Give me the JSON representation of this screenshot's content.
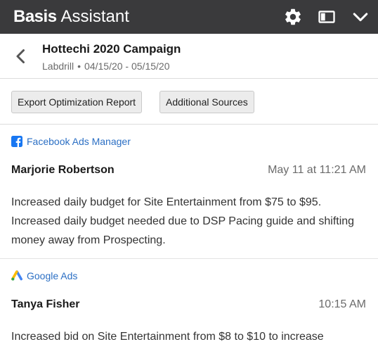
{
  "app": {
    "brand_bold": "Basis",
    "brand_light": "Assistant",
    "icons": [
      "gear-icon",
      "panel-icon",
      "chevron-down-icon"
    ],
    "colors": {
      "titlebar": "#3a3a3c",
      "link": "#2b6fc4",
      "facebook": "#1877f2",
      "google_blue": "#4285f4",
      "google_yellow": "#fbbc04",
      "google_green": "#34a853"
    }
  },
  "header": {
    "title": "Hottechi 2020 Campaign",
    "client": "Labdrill",
    "separator": "•",
    "date_range": "04/15/20 - 05/15/20"
  },
  "toolbar": {
    "export_label": "Export Optimization Report",
    "sources_label": "Additional Sources"
  },
  "entries": [
    {
      "source": "Facebook Ads Manager",
      "source_icon": "facebook-icon",
      "author": "Marjorie Robertson",
      "time": "May 11 at 11:21 AM",
      "text": "Increased daily budget for Site Entertainment from $75 to $95. Increased daily budget needed due to DSP Pacing guide and shifting money away from Prospecting."
    },
    {
      "source": "Google Ads",
      "source_icon": "google-ads-icon",
      "author": "Tanya Fisher",
      "time": "10:15 AM",
      "text": "Increased bid on Site Entertainment from $8 to $10 to increase"
    }
  ]
}
